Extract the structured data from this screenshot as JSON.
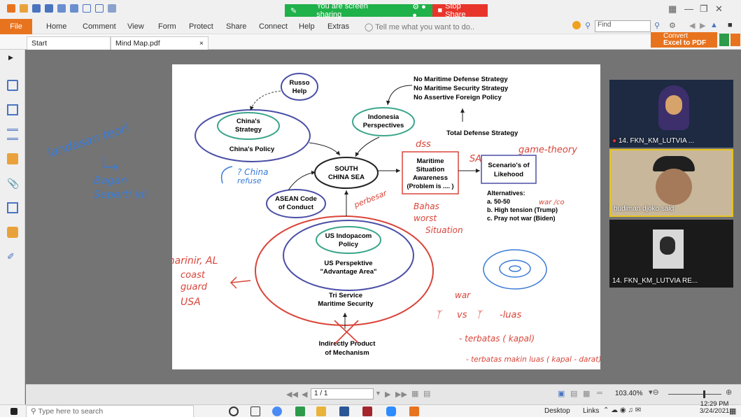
{
  "titlebar": {
    "share_text": "You are screen sharing",
    "stop_label": "Stop Share"
  },
  "ribbon": {
    "file": "File",
    "menus": [
      "Home",
      "Comment",
      "View",
      "Form",
      "Protect",
      "Share",
      "Connect",
      "Help",
      "Extras"
    ],
    "tell_me": "Tell me what you want to do..",
    "find_placeholder": "Find",
    "convert_line1": "Convert",
    "convert_line2": "Excel to PDF"
  },
  "tabs": {
    "start": "Start",
    "doc": "Mind Map.pdf",
    "close": "×"
  },
  "diagram": {
    "russo": [
      "Russo",
      "Help"
    ],
    "chinas_strategy": [
      "China's",
      "Strategy"
    ],
    "chinas_policy": "China's Policy",
    "indonesia": [
      "Indonesia",
      "Perspectives"
    ],
    "no_strategies": [
      "No Maritime Defense Strategy",
      "No Maritime Security Strategy",
      "No Assertive Foreign Policy"
    ],
    "total_defense": "Total Defense Strategy",
    "scs": [
      "SOUTH",
      "CHINA SEA"
    ],
    "maritime": [
      "Maritime",
      "Situation",
      "Awareness",
      "(Problem is .... )"
    ],
    "scenarios": [
      "Scenario's of",
      "Likehood"
    ],
    "alternatives": [
      "Alternatives:",
      "a. 50-50",
      "b. High tension (Trump)",
      "c. Pray not war (Biden)"
    ],
    "asean": [
      "ASEAN Code",
      "of Conduct"
    ],
    "indopacom": [
      "US Indopacom",
      "Policy"
    ],
    "us_perspective": [
      "US Perspektive",
      "\"Advantage Area\""
    ],
    "tri_service": [
      "Tri Service",
      "Maritime Security"
    ],
    "indirect": [
      "Indirectly Product",
      "of Mechanism"
    ]
  },
  "annotations": {
    "landasan": [
      "landasan teori",
      "Bagan",
      "Seperti ini"
    ],
    "dss": "dss",
    "sa": "SA",
    "game_theory": "game-theory",
    "china_refuse": [
      "? China",
      "refuse"
    ],
    "perbesar": "perbesar",
    "bahas": [
      "Bahas",
      "worst",
      "Situation"
    ],
    "war_co": "war /co",
    "marinir": [
      "marinir, AL",
      "coast",
      "guard",
      "USA"
    ],
    "war": "war",
    "vs": "vs",
    "luas": "-luas",
    "terbatas1": "- terbatas ( kapal)",
    "terbatas2": "- terbatas makin luas ( kapal - darat) | tak"
  },
  "participants": [
    {
      "name": "14. FKN_KM_LUTVIA ..."
    },
    {
      "name": "budiman djoko said"
    },
    {
      "name": "14. FKN_KM_LUTVIA RE..."
    }
  ],
  "statusbar": {
    "page": "1 / 1",
    "zoom": "103.40%"
  },
  "taskbar": {
    "search_placeholder": "Type here to search",
    "desktop": "Desktop",
    "links": "Links",
    "time": "12:29 PM",
    "date": "3/24/2021"
  }
}
